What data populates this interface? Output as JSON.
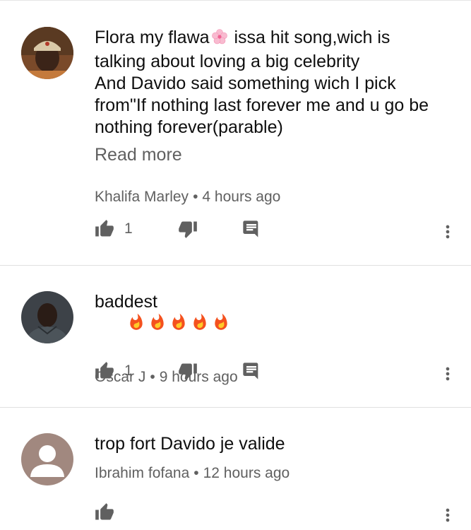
{
  "comments": [
    {
      "text_line1_a": "Flora my flawa",
      "emoji1": "cherry-blossom",
      "text_line1_b": " issa hit song,wich is",
      "text_rest": "talking about loving a big celebrity\nAnd Davido said something wich I pick\nfrom\"If nothing last forever me and u go be\nnothing forever(parable)",
      "read_more": "Read more",
      "author": "Khalifa Marley",
      "time": "4 hours ago",
      "likes": "1"
    },
    {
      "text": "baddest",
      "emoji": "fire x5",
      "author": "Oscar J",
      "time": "9 hours ago",
      "likes": "1"
    },
    {
      "text": "trop fort Davido je valide",
      "author": "Ibrahim fofana",
      "time": "12 hours ago"
    }
  ],
  "separator": "•",
  "colors": {
    "text": "#0f0f0f",
    "secondary": "#606060",
    "divider": "#e0e0e0",
    "fire": "#f4511e"
  }
}
